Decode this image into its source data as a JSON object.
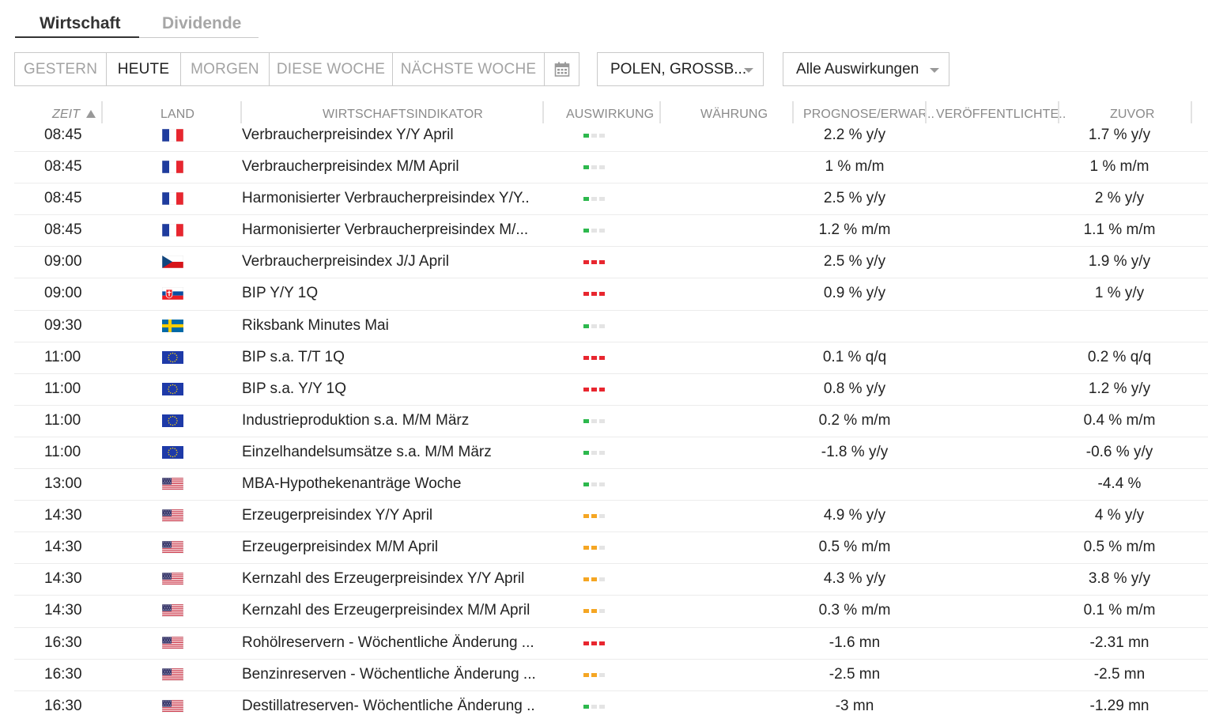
{
  "tabs": {
    "active": "Wirtschaft",
    "inactive": "Dividende"
  },
  "day_buttons": [
    {
      "label": "GESTERN",
      "active": false
    },
    {
      "label": "HEUTE",
      "active": true
    },
    {
      "label": "MORGEN",
      "active": false
    },
    {
      "label": "DIESE WOCHE",
      "active": false
    },
    {
      "label": "NÄCHSTE WOCHE",
      "active": false
    }
  ],
  "calendar_icon": "calendar-icon",
  "country_filter": {
    "value": "POLEN, GROSSB..."
  },
  "impact_filter": {
    "value": "Alle Auswirkungen"
  },
  "columns": {
    "time": "ZEIT",
    "country": "LAND",
    "indicator": "WIRTSCHAFTSINDIKATOR",
    "impact": "AUSWIRKUNG",
    "currency": "WÄHRUNG",
    "forecast": "PROGNOSE/ERWAR..",
    "published": "VERÖFFENTLICHTE..",
    "previous": "ZUVOR"
  },
  "sort_indicator": "sort-ascending-icon",
  "impact_colors": {
    "low": "#2db84d",
    "medium": "#f5a623",
    "high": "#e8262f",
    "empty": "#e4e4e4"
  },
  "rows": [
    {
      "time": "08:45",
      "country": "fr",
      "indicator": "Verbraucherpreisindex Y/Y April",
      "impact": "low",
      "forecast": "2.2 % y/y",
      "previous": "1.7 % y/y"
    },
    {
      "time": "08:45",
      "country": "fr",
      "indicator": "Verbraucherpreisindex M/M April",
      "impact": "low",
      "forecast": "1 % m/m",
      "previous": "1 % m/m"
    },
    {
      "time": "08:45",
      "country": "fr",
      "indicator": "Harmonisierter Verbraucherpreisindex Y/Y..",
      "impact": "low",
      "forecast": "2.5 % y/y",
      "previous": "2 % y/y"
    },
    {
      "time": "08:45",
      "country": "fr",
      "indicator": "Harmonisierter Verbraucherpreisindex M/...",
      "impact": "low",
      "forecast": "1.2 % m/m",
      "previous": "1.1 % m/m"
    },
    {
      "time": "09:00",
      "country": "cz",
      "indicator": "Verbraucherpreisindex J/J April",
      "impact": "high",
      "forecast": "2.5 % y/y",
      "previous": "1.9 % y/y"
    },
    {
      "time": "09:00",
      "country": "sk",
      "indicator": "BIP Y/Y 1Q",
      "impact": "high",
      "forecast": "0.9 % y/y",
      "previous": "1 % y/y"
    },
    {
      "time": "09:30",
      "country": "se",
      "indicator": "Riksbank Minutes Mai",
      "impact": "low",
      "forecast": "",
      "previous": ""
    },
    {
      "time": "11:00",
      "country": "eu",
      "indicator": "BIP s.a. T/T 1Q",
      "impact": "high",
      "forecast": "0.1 % q/q",
      "previous": "0.2 % q/q"
    },
    {
      "time": "11:00",
      "country": "eu",
      "indicator": "BIP s.a. Y/Y 1Q",
      "impact": "high",
      "forecast": "0.8 % y/y",
      "previous": "1.2 % y/y"
    },
    {
      "time": "11:00",
      "country": "eu",
      "indicator": "Industrieproduktion s.a. M/M März",
      "impact": "low",
      "forecast": "0.2 % m/m",
      "previous": "0.4 % m/m"
    },
    {
      "time": "11:00",
      "country": "eu",
      "indicator": "Einzelhandelsumsätze s.a. M/M März",
      "impact": "low",
      "forecast": "-1.8 % y/y",
      "previous": "-0.6 % y/y"
    },
    {
      "time": "13:00",
      "country": "us",
      "indicator": "MBA-Hypothekenanträge Woche",
      "impact": "low",
      "forecast": "",
      "previous": "-4.4 %"
    },
    {
      "time": "14:30",
      "country": "us",
      "indicator": "Erzeugerpreisindex Y/Y April",
      "impact": "medium",
      "forecast": "4.9 % y/y",
      "previous": "4 % y/y"
    },
    {
      "time": "14:30",
      "country": "us",
      "indicator": "Erzeugerpreisindex M/M April",
      "impact": "medium",
      "forecast": "0.5 % m/m",
      "previous": "0.5 % m/m"
    },
    {
      "time": "14:30",
      "country": "us",
      "indicator": "Kernzahl des Erzeugerpreisindex Y/Y April",
      "impact": "medium",
      "forecast": "4.3 % y/y",
      "previous": "3.8 % y/y"
    },
    {
      "time": "14:30",
      "country": "us",
      "indicator": "Kernzahl des Erzeugerpreisindex M/M April",
      "impact": "medium",
      "forecast": "0.3 % m/m",
      "previous": "0.1 % m/m"
    },
    {
      "time": "16:30",
      "country": "us",
      "indicator": "Rohölreservern - Wöchentliche Änderung ...",
      "impact": "high",
      "forecast": "-1.6 mn",
      "previous": "-2.31 mn"
    },
    {
      "time": "16:30",
      "country": "us",
      "indicator": "Benzinreserven - Wöchentliche Änderung ...",
      "impact": "medium",
      "forecast": "-2.5 mn",
      "previous": "-2.5 mn"
    },
    {
      "time": "16:30",
      "country": "us",
      "indicator": "Destillatreserven- Wöchentliche Änderung ..",
      "impact": "low",
      "forecast": "-3 mn",
      "previous": "-1.29 mn"
    }
  ]
}
